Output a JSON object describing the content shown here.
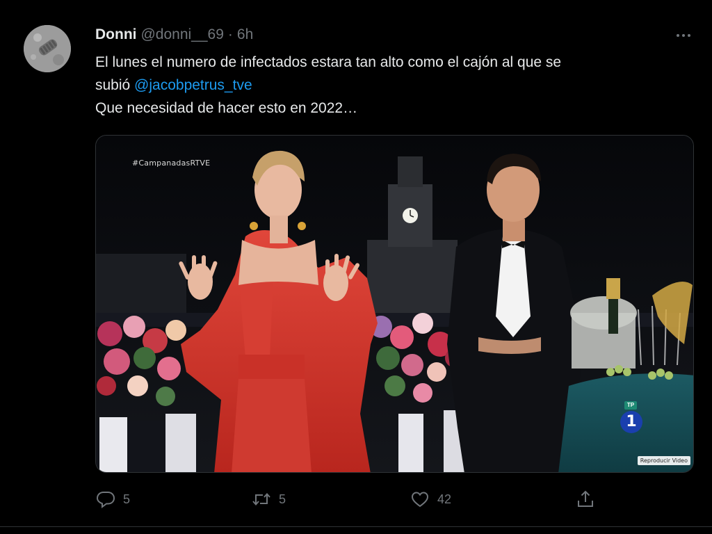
{
  "tweet": {
    "author": {
      "display_name": "Donni",
      "handle": "@donni__69",
      "separator": "·",
      "timestamp": "6h"
    },
    "text": {
      "line1": "El lunes el numero de infectados estara tan alto como el cajón al que se",
      "line2_prefix": "subió ",
      "mention": "@jacobpetrus_tve",
      "line3": "Que necesidad de hacer esto en 2022…"
    },
    "media": {
      "hashtag_overlay": "#CampanadasRTVE",
      "channel_tag": "TP",
      "channel_number": "1",
      "player_label": "Reproducir Video"
    },
    "actions": {
      "reply_count": "5",
      "retweet_count": "5",
      "like_count": "42"
    },
    "icons": {
      "more": "more-horizontal-icon",
      "reply": "reply-icon",
      "retweet": "retweet-icon",
      "like": "heart-icon",
      "share": "share-icon"
    },
    "colors": {
      "background": "#000000",
      "primary_text": "#e7e9ea",
      "secondary_text": "#71767b",
      "link": "#1d9bf0"
    }
  }
}
